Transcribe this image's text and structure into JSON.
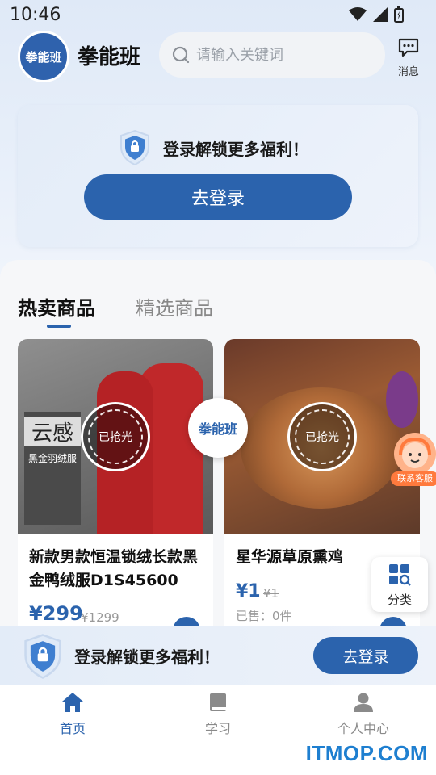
{
  "status_bar": {
    "time": "10:46"
  },
  "header": {
    "logo_text": "拳能班",
    "brand": "拳能班",
    "search_placeholder": "请输入关键词",
    "message_label": "消息"
  },
  "login_card": {
    "text": "登录解锁更多福利！",
    "button": "去登录"
  },
  "tabs": [
    {
      "label": "热卖商品",
      "active": true
    },
    {
      "label": "精选商品",
      "active": false
    }
  ],
  "products": [
    {
      "image_text_1": "云感",
      "image_text_2": "黑金羽绒服",
      "status": "已抢光",
      "title": "新款男款恒温锁绒长款黑金鸭绒服D1S45600",
      "price": "¥299",
      "original_price": "¥1299"
    },
    {
      "status": "已抢光",
      "title": "星华源草原熏鸡",
      "price": "¥1",
      "original_price": "¥1",
      "sold": "已售：0件"
    }
  ],
  "center_badge": "拳能班",
  "service_label": "联系客服",
  "category_label": "分类",
  "bottom_bar": {
    "text": "登录解锁更多福利！",
    "button": "去登录"
  },
  "tabbar": [
    {
      "label": "首页",
      "icon": "home-icon",
      "active": true
    },
    {
      "label": "学习",
      "icon": "book-icon",
      "active": false
    },
    {
      "label": "个人中心",
      "icon": "person-icon",
      "active": false
    }
  ],
  "watermark": "ITMOP.COM",
  "colors": {
    "primary": "#2b63ad",
    "accent": "#ff7a3d"
  }
}
